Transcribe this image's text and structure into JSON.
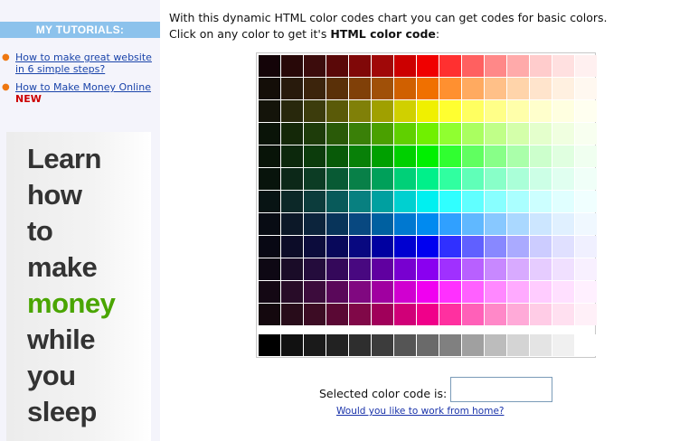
{
  "sidebar": {
    "header": "MY TUTORIALS:",
    "tutorials": [
      {
        "label": "How to make great website in 6 simple steps?"
      },
      {
        "label": "How to Make Money Online",
        "badge": "NEW"
      }
    ],
    "ad": {
      "words": [
        "Learn",
        "how",
        "to",
        "make",
        "money",
        "while",
        "you",
        "sleep"
      ],
      "highlight_word": "money",
      "highlight_color": "#4aa500"
    }
  },
  "main": {
    "intro_line1": "With this dynamic HTML color codes chart you can get codes for basic colors.",
    "intro_line2_prefix": "Click on any color to get it's ",
    "intro_line2_bold": "HTML color code",
    "intro_line2_suffix": ":",
    "selected_label": "Selected color code is:",
    "selected_value": "",
    "work_link": "Would you like to work from home?"
  },
  "color_chart": {
    "rows": [
      [
        "#140408",
        "#280808",
        "#3c0c0c",
        "#5a0808",
        "#800808",
        "#a00808",
        "#cc0000",
        "#f00000",
        "#ff3030",
        "#ff6060",
        "#ff8888",
        "#ffaaaa",
        "#ffcccc",
        "#ffe0e0",
        "#fff0f0"
      ],
      [
        "#140e08",
        "#281a0c",
        "#3c240c",
        "#5a3008",
        "#804008",
        "#a05008",
        "#d06000",
        "#f07000",
        "#ff9030",
        "#ffaa60",
        "#ffc088",
        "#ffd4aa",
        "#ffe4cc",
        "#fff0e0",
        "#fff8f0"
      ],
      [
        "#14140a",
        "#28280c",
        "#3c3c0c",
        "#5a5a08",
        "#808008",
        "#a0a000",
        "#d0d000",
        "#f0f000",
        "#ffff30",
        "#ffff60",
        "#ffff88",
        "#ffffaa",
        "#ffffcc",
        "#ffffe0",
        "#fffff0"
      ],
      [
        "#0a1408",
        "#142808",
        "#1e3c0a",
        "#2a5a08",
        "#3a8008",
        "#4aa000",
        "#60d000",
        "#70f000",
        "#90ff30",
        "#aaff60",
        "#c0ff88",
        "#d4ffaa",
        "#e4ffcc",
        "#f0ffe0",
        "#f8fff0"
      ],
      [
        "#081408",
        "#0c280c",
        "#0c3c0c",
        "#085a08",
        "#088008",
        "#00a000",
        "#00d000",
        "#00f000",
        "#30ff30",
        "#60ff60",
        "#88ff88",
        "#aaffaa",
        "#ccffcc",
        "#e0ffe0",
        "#f0fff0"
      ],
      [
        "#08140c",
        "#0c2818",
        "#0c3c24",
        "#085a34",
        "#088048",
        "#00a05a",
        "#00d078",
        "#00f08a",
        "#30ffa0",
        "#60ffb8",
        "#88ffc8",
        "#aaffd8",
        "#ccffe6",
        "#e0fff0",
        "#f0fff8"
      ],
      [
        "#081414",
        "#0c2828",
        "#0c3c3c",
        "#085a5a",
        "#088080",
        "#00a0a0",
        "#00d0d0",
        "#00f0f0",
        "#30ffff",
        "#60ffff",
        "#88ffff",
        "#aaffff",
        "#ccffff",
        "#e0ffff",
        "#f0ffff"
      ],
      [
        "#080c14",
        "#0c1828",
        "#0c243c",
        "#08345a",
        "#084880",
        "#0060a0",
        "#0078d0",
        "#008af0",
        "#30a0ff",
        "#60b8ff",
        "#88c8ff",
        "#aad8ff",
        "#cce6ff",
        "#e0f0ff",
        "#f0f8ff"
      ],
      [
        "#080814",
        "#0c0c28",
        "#0c0c3c",
        "#08085a",
        "#080880",
        "#0000a0",
        "#0000d0",
        "#0000f0",
        "#3030ff",
        "#6060ff",
        "#8888ff",
        "#aaaaff",
        "#ccccff",
        "#e0e0ff",
        "#f0f0ff"
      ],
      [
        "#0e0814",
        "#1a0c28",
        "#240c3c",
        "#34085a",
        "#480880",
        "#6000a0",
        "#7800d0",
        "#8a00f0",
        "#a030ff",
        "#b860ff",
        "#c888ff",
        "#d8aaff",
        "#e6ccff",
        "#f0e0ff",
        "#f8f0ff"
      ],
      [
        "#140814",
        "#280c28",
        "#3c0c3c",
        "#5a085a",
        "#800880",
        "#a000a0",
        "#d000d0",
        "#f000f0",
        "#ff30ff",
        "#ff60ff",
        "#ff88ff",
        "#ffaaff",
        "#ffccff",
        "#ffe0ff",
        "#fff0ff"
      ],
      [
        "#14080e",
        "#280c1a",
        "#3c0c24",
        "#5a0834",
        "#800848",
        "#a0005a",
        "#d00078",
        "#f0008a",
        "#ff30a0",
        "#ff60b8",
        "#ff88c8",
        "#ffaad8",
        "#ffcce6",
        "#ffe0f0",
        "#fff0f8"
      ]
    ],
    "grays": [
      "#000000",
      "#111111",
      "#1a1a1a",
      "#222222",
      "#2e2e2e",
      "#3c3c3c",
      "#555555",
      "#6a6a6a",
      "#808080",
      "#a0a0a0",
      "#bcbcbc",
      "#d4d4d4",
      "#e4e4e4",
      "#f0f0f0",
      "#ffffff"
    ]
  }
}
